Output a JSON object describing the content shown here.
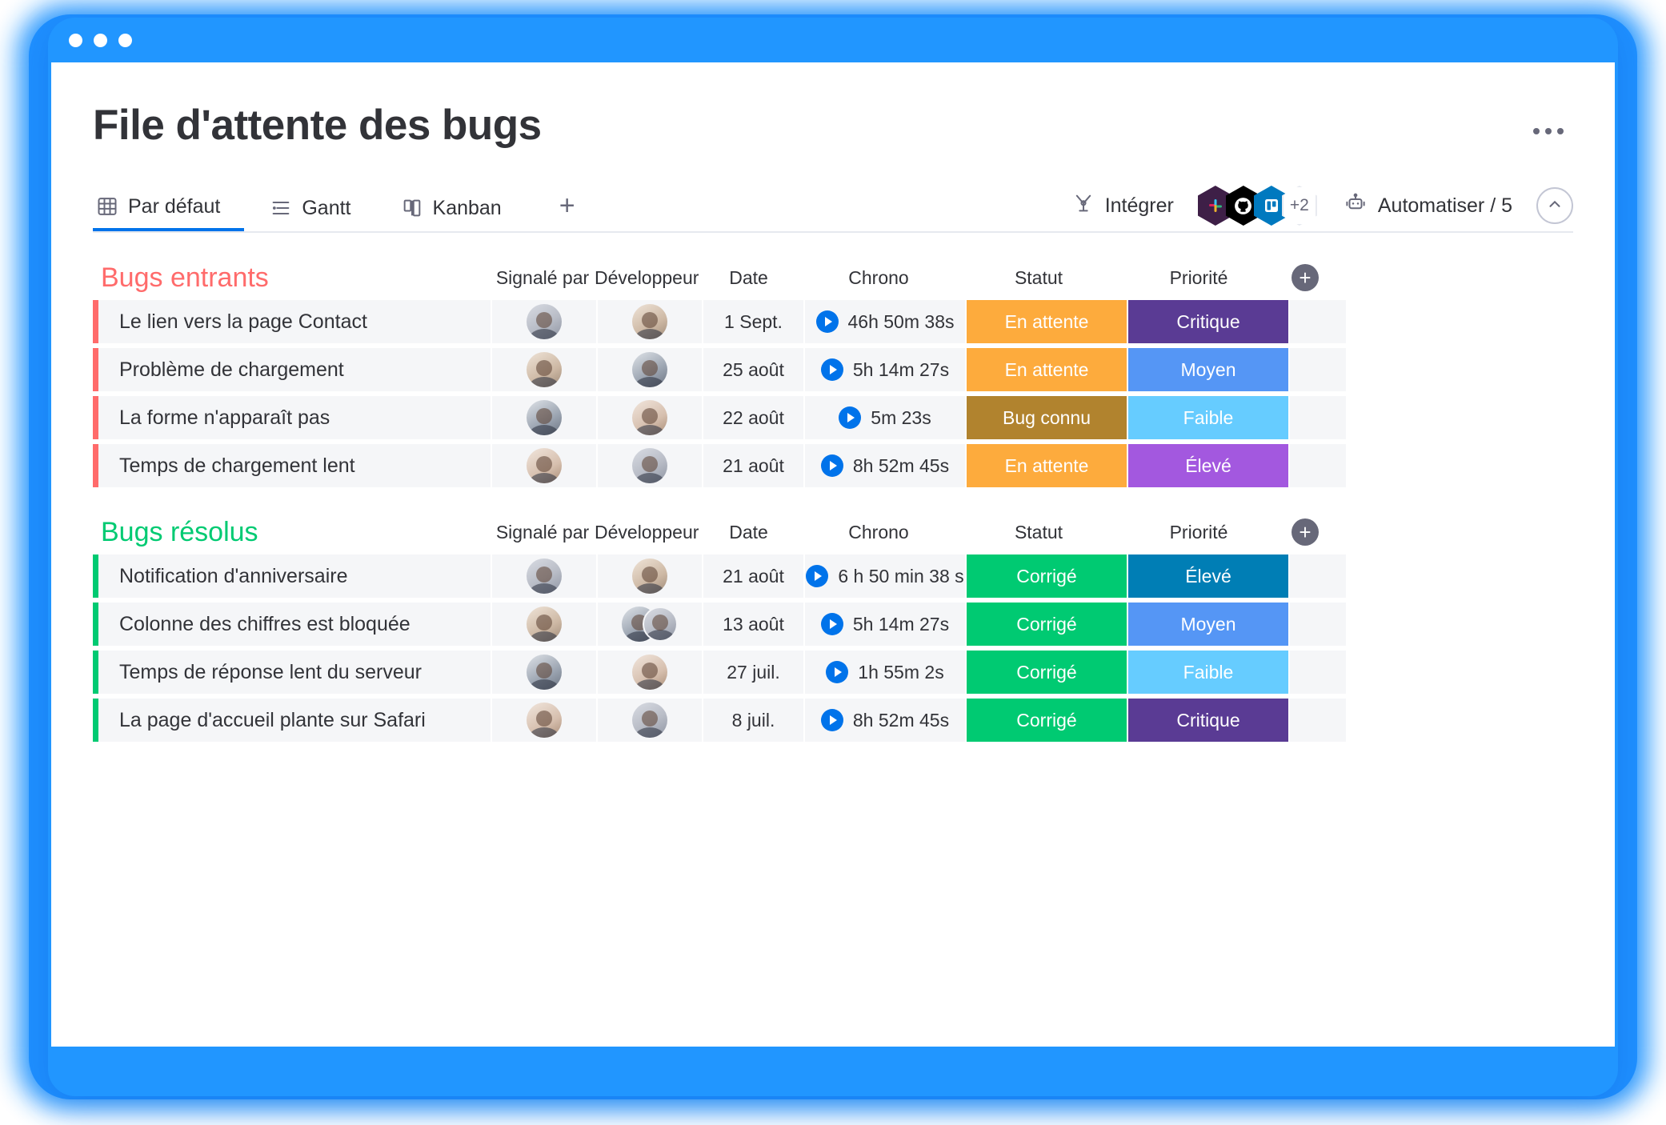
{
  "window": {
    "dots": [
      "close",
      "minimize",
      "maximize"
    ],
    "accent": "#2196ff"
  },
  "header": {
    "title": "File d'attente des bugs",
    "more_label": "..."
  },
  "tabs": [
    {
      "label": "Par défaut",
      "icon": "table-icon",
      "active": true
    },
    {
      "label": "Gantt",
      "icon": "gantt-icon",
      "active": false
    },
    {
      "label": "Kanban",
      "icon": "kanban-icon",
      "active": false
    }
  ],
  "tab_add_label": "+",
  "toolbar": {
    "integrate_label": "Intégrer",
    "integrations": [
      {
        "name": "slack",
        "color": "#3e1f47"
      },
      {
        "name": "github",
        "color": "#000000"
      },
      {
        "name": "trello",
        "color": "#0079bf"
      }
    ],
    "integrations_overflow": "+2",
    "automate_label": "Automatiser / 5",
    "collapse_icon": "chevron-up-icon"
  },
  "columns": [
    "Signalé par",
    "Développeur",
    "Date",
    "Chrono",
    "Statut",
    "Priorité"
  ],
  "add_column_label": "+",
  "groups": [
    {
      "title": "Bugs entrants",
      "color": "#ff6b6b",
      "rows": [
        {
          "name": "Le lien vers la page Contact",
          "date": "1 Sept.",
          "chrono": "46h 50m 38s",
          "status": {
            "label": "En attente",
            "color": "#fdab3d"
          },
          "priority": {
            "label": "Critique",
            "color": "#5a3b94"
          },
          "reporter_avatars": 1,
          "developer_avatars": 1
        },
        {
          "name": "Problème de chargement",
          "date": "25 août",
          "chrono": "5h 14m 27s",
          "status": {
            "label": "En attente",
            "color": "#fdab3d"
          },
          "priority": {
            "label": "Moyen",
            "color": "#5596f5"
          },
          "reporter_avatars": 1,
          "developer_avatars": 1
        },
        {
          "name": "La forme n'apparaît pas",
          "date": "22 août",
          "chrono": "5m 23s",
          "status": {
            "label": "Bug connu",
            "color": "#b1832e"
          },
          "priority": {
            "label": "Faible",
            "color": "#66ccff"
          },
          "reporter_avatars": 1,
          "developer_avatars": 1
        },
        {
          "name": "Temps de chargement lent",
          "date": "21 août",
          "chrono": "8h 52m 45s",
          "status": {
            "label": "En attente",
            "color": "#fdab3d"
          },
          "priority": {
            "label": "Élevé",
            "color": "#a councils"
          },
          "reporter_avatars": 1,
          "developer_avatars": 1
        }
      ]
    },
    {
      "title": "Bugs résolus",
      "color": "#00ca72",
      "rows": [
        {
          "name": "Notification d'anniversaire",
          "date": "21 août",
          "chrono": "6 h 50 min 38 s",
          "status": {
            "label": "Corrigé",
            "color": "#00ca72"
          },
          "priority": {
            "label": "Élevé",
            "color": "#007eb5"
          },
          "reporter_avatars": 1,
          "developer_avatars": 1
        },
        {
          "name": "Colonne des chiffres est bloquée",
          "date": "13 août",
          "chrono": "5h 14m 27s",
          "status": {
            "label": "Corrigé",
            "color": "#00ca72"
          },
          "priority": {
            "label": "Moyen",
            "color": "#5596f5"
          },
          "reporter_avatars": 1,
          "developer_avatars": 2
        },
        {
          "name": "Temps de réponse lent du serveur",
          "date": "27 juil.",
          "chrono": "1h 55m 2s",
          "status": {
            "label": "Corrigé",
            "color": "#00ca72"
          },
          "priority": {
            "label": "Faible",
            "color": "#66ccff"
          },
          "reporter_avatars": 1,
          "developer_avatars": 1
        },
        {
          "name": "La page d'accueil plante sur Safari",
          "date": "8 juil.",
          "chrono": "8h 52m 45s",
          "status": {
            "label": "Corrigé",
            "color": "#00ca72"
          },
          "priority": {
            "label": "Critique",
            "color": "#5a3b94"
          },
          "reporter_avatars": 1,
          "developer_avatars": 1
        }
      ]
    }
  ]
}
